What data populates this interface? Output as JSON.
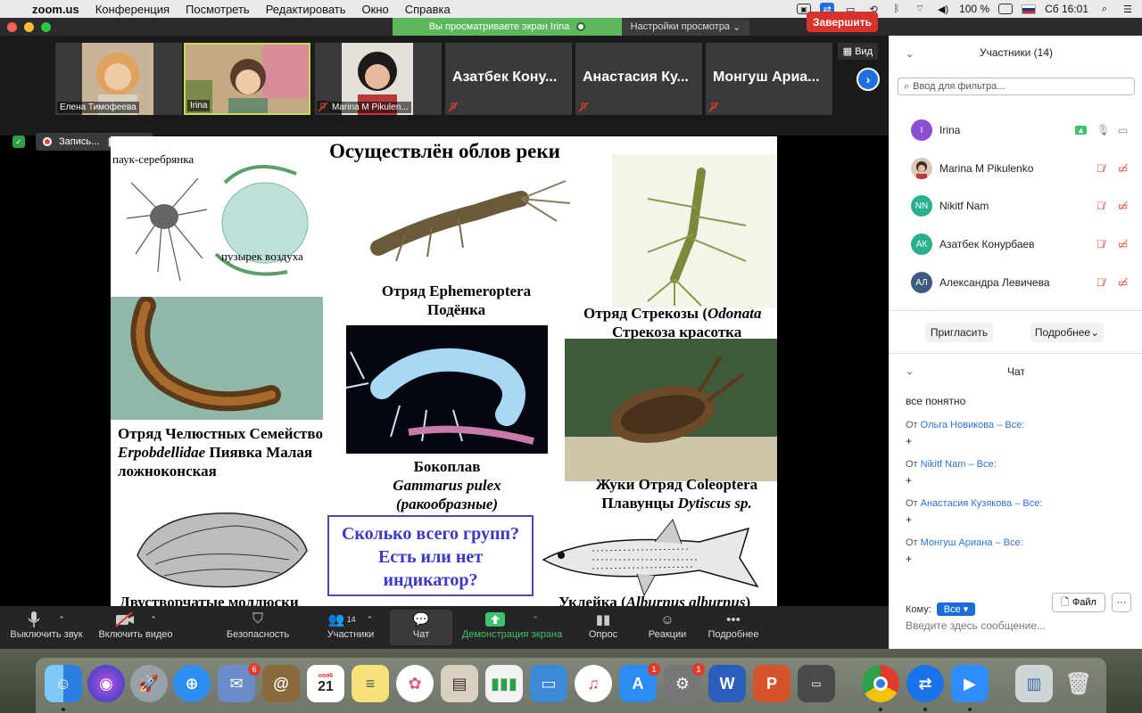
{
  "menubar": {
    "app": "zoom.us",
    "items": [
      "Конференция",
      "Посмотреть",
      "Редактировать",
      "Окно",
      "Справка"
    ],
    "battery": "100 %",
    "clock": "Сб 16:01"
  },
  "window": {
    "share_banner": "Вы просматриваете экран Irina",
    "view_options": "Настройки просмотра"
  },
  "strip": {
    "view_label": "Вид",
    "tiles": [
      {
        "name": "Елена Тимофеева",
        "has_video": true
      },
      {
        "name": "Irina",
        "has_video": true,
        "active": true
      },
      {
        "name": "Marina M Pikulen...",
        "has_video": true,
        "muted": true
      },
      {
        "name": "Азатбек Кону...",
        "has_video": false,
        "muted": true
      },
      {
        "name": "Анастасия Ку...",
        "has_video": false,
        "muted": true
      },
      {
        "name": "Монгуш Ариа...",
        "has_video": false,
        "muted": true
      }
    ]
  },
  "recording": {
    "label": "Запись..."
  },
  "slide": {
    "title": "Осуществлён облов реки",
    "spider_label": "паук-серебрянка",
    "bubble_label": "пузырек воздуха",
    "mayfly_line1": "Отряд Ephemeroptera",
    "mayfly_line2": "Подёнка",
    "dragonfly_line1": "Отряд Стрекозы (",
    "dragonfly_latin": "Odonata",
    "dragonfly_line2": "Стрекоза красотка",
    "leech_line1": "Отряд Челюстных Семейство",
    "leech_latin": "Erpobdellidae",
    "leech_line2_rest": " Пиявка Малая",
    "leech_line3": "ложноконская",
    "amphipod_line1": "Бокоплав",
    "amphipod_latin": "Gammarus pulex",
    "amphipod_line3": "(ракообразные)",
    "beetle_line1": "Жуки Отряд Coleoptera",
    "beetle_line2_prefix": "Плавунцы ",
    "beetle_latin": "Dytiscus sp.",
    "mollusk": "Двустворчатые моллюски",
    "fish_prefix": "Уклейка (",
    "fish_latin": "Alburnus alburnus",
    "fish_suffix": ")",
    "question": "Сколько всего групп? Есть или нет индикатор?"
  },
  "toolbar": {
    "mute": "Выключить звук",
    "video": "Включить видео",
    "security": "Безопасность",
    "participants": "Участники",
    "participants_count": "14",
    "chat": "Чат",
    "share": "Демонстрация экрана",
    "poll": "Опрос",
    "reactions": "Реакции",
    "more": "Подробнее",
    "end": "Завершить"
  },
  "panel": {
    "title": "Участники (14)",
    "filter_placeholder": "Ввод для фильтра...",
    "participants": [
      {
        "name": "Irina",
        "initials": "I",
        "color": "#8c4fd1"
      },
      {
        "name": "Marina M Pikulenko",
        "initials": "",
        "color": "#9a5a3a"
      },
      {
        "name": "Nikitf Nam",
        "initials": "NN",
        "color": "#29b08c"
      },
      {
        "name": "Азатбек Конурбаев",
        "initials": "АК",
        "color": "#29b08c"
      },
      {
        "name": "Александра Левичева",
        "initials": "АЛ",
        "color": "#3d5a80"
      }
    ],
    "invite": "Пригласить",
    "more": "Подробнее",
    "chat_title": "Чат",
    "chat_first": "все понятно",
    "messages": [
      {
        "prefix": "От ",
        "sender": "Ольга Новикова",
        "to": " – Все:",
        "text": "+"
      },
      {
        "prefix": "От ",
        "sender": "Nikitf Nam",
        "to": " – Все:",
        "text": "+"
      },
      {
        "prefix": "От ",
        "sender": "Анастасия Кузякова",
        "to": " – Все:",
        "text": "+"
      },
      {
        "prefix": "От ",
        "sender": "Монгуш Ариана",
        "to": " – Все:",
        "text": "+"
      }
    ],
    "to_label": "Кому:",
    "to_value": "Все",
    "file": "Файл",
    "input_placeholder": "Введите здесь сообщение..."
  },
  "dock": {
    "calendar_month": "ноя6",
    "calendar_day": "21",
    "badges": {
      "mail": "6",
      "appstore": "1",
      "prefs": "1"
    }
  }
}
